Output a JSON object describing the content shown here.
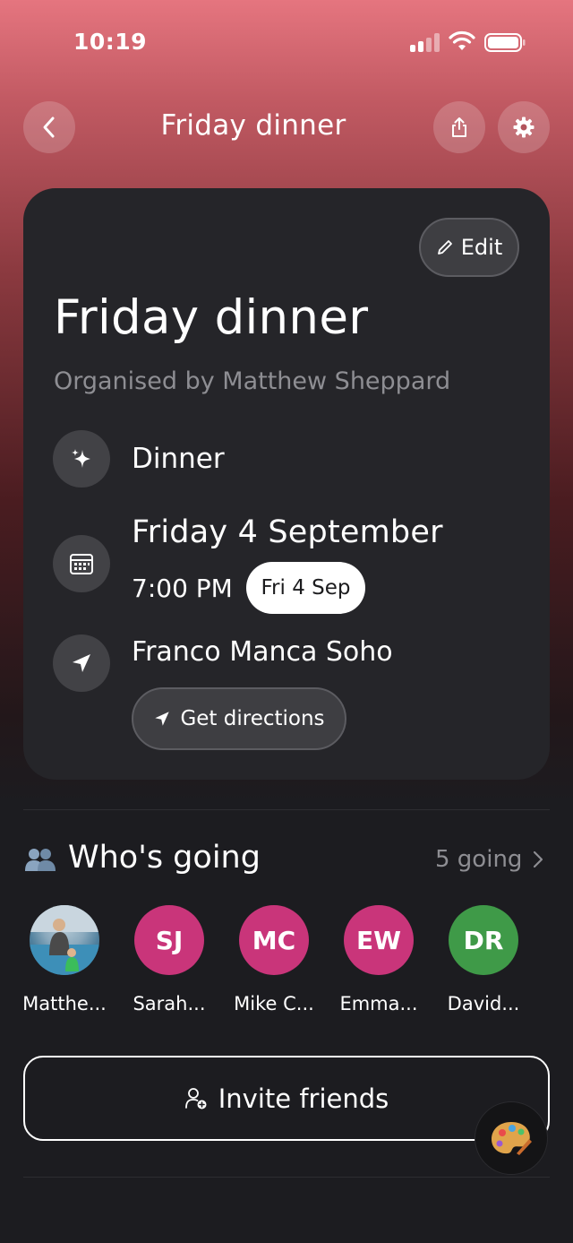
{
  "status_bar": {
    "time": "10:19"
  },
  "header": {
    "title": "Friday dinner",
    "back_icon": "chevron-left-icon",
    "share_icon": "share-icon",
    "settings_icon": "gear-icon"
  },
  "event": {
    "edit_label": "Edit",
    "title": "Friday dinner",
    "organiser": "Organised by Matthew Sheppard",
    "type": "Dinner",
    "date": "Friday 4 September",
    "time": "7:00 PM",
    "date_pill": "Fri 4 Sep",
    "location": "Franco Manca Soho",
    "directions_label": "Get directions"
  },
  "going": {
    "title": "Who's going",
    "count_label": "5 going",
    "attendees": [
      {
        "name": "Matthe...",
        "initials": "",
        "color": "#4f7f9c"
      },
      {
        "name": "Sarah...",
        "initials": "SJ",
        "color": "#c9357a"
      },
      {
        "name": "Mike C...",
        "initials": "MC",
        "color": "#c9357a"
      },
      {
        "name": "Emma...",
        "initials": "EW",
        "color": "#c9357a"
      },
      {
        "name": "David...",
        "initials": "DR",
        "color": "#3f9a48"
      }
    ]
  },
  "invite": {
    "label": "Invite friends"
  },
  "colors": {
    "card_bg": "#252529",
    "accent_pink": "#c9357a",
    "accent_green": "#3f9a48"
  }
}
